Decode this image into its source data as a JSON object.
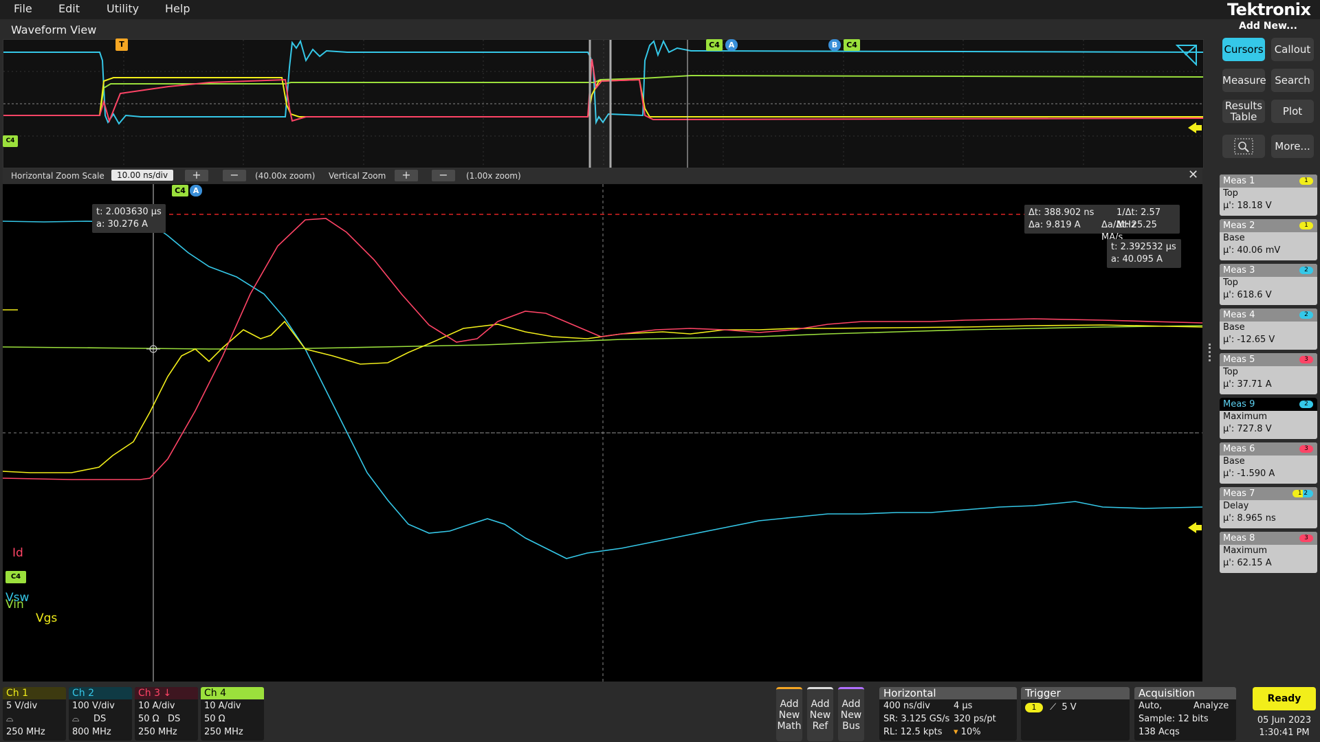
{
  "menu": [
    "File",
    "Edit",
    "Utility",
    "Help"
  ],
  "brand": "Tektronix",
  "add_new": "Add New...",
  "waveform_view": {
    "title": "Waveform View"
  },
  "zoom": {
    "h_label": "Horizontal Zoom Scale",
    "h_value": "10.00 ns/div",
    "h_factor": "(40.00x zoom)",
    "v_label": "Vertical Zoom",
    "v_factor": "(1.00x zoom)",
    "close": "✕"
  },
  "cursor_a": {
    "t": "t: 2.003630 µs",
    "a": "a: 30.276 A"
  },
  "cursor_b": {
    "t": "t: 2.392532 µs",
    "a": "a: 40.095 A"
  },
  "delta": {
    "dt": "Δt: 388.902 ns",
    "inv_dt": "1/Δt: 2.57 MHz",
    "da": "Δa: 9.819 A",
    "da_dt": "Δa/Δt: 25.25 MA/s"
  },
  "markers": {
    "t": "T",
    "c4": "C4",
    "a": "A",
    "b": "B"
  },
  "trace_labels": {
    "id": "Id",
    "vsw": "Vsw",
    "vin": "Vin",
    "vgs": "Vgs"
  },
  "right_panel": {
    "buttons": [
      "Cursors",
      "Callout",
      "Measure",
      "Search",
      "Results Table",
      "Plot",
      "More..."
    ],
    "measurements": [
      {
        "name": "Meas 1",
        "badge": "1",
        "type": "Top",
        "value": "µ': 18.18 V",
        "color": "#f2ee1a"
      },
      {
        "name": "Meas 2",
        "badge": "1",
        "type": "Base",
        "value": "µ': 40.06 mV",
        "color": "#f2ee1a"
      },
      {
        "name": "Meas 3",
        "badge": "2",
        "type": "Top",
        "value": "µ': 618.6 V",
        "color": "#35c8e8"
      },
      {
        "name": "Meas 4",
        "badge": "2",
        "type": "Base",
        "value": "µ': -12.65 V",
        "color": "#35c8e8"
      },
      {
        "name": "Meas 5",
        "badge": "3",
        "type": "Top",
        "value": "µ': 37.71 A",
        "color": "#ff4466"
      },
      {
        "name": "Meas 9",
        "badge": "2",
        "type": "Maximum",
        "value": "µ': 727.8 V",
        "color": "#35c8e8",
        "active": true
      },
      {
        "name": "Meas 6",
        "badge": "3",
        "type": "Base",
        "value": "µ': -1.590 A",
        "color": "#ff4466"
      },
      {
        "name": "Meas 7",
        "badge": "1  2",
        "type": "Delay",
        "value": "µ': 8.965 ns",
        "color": "#f2ee1a"
      },
      {
        "name": "Meas 8",
        "badge": "3",
        "type": "Maximum",
        "value": "µ': 62.15 A",
        "color": "#ff4466"
      }
    ]
  },
  "channels": [
    {
      "name": "Ch 1",
      "l1": "5 V/div",
      "l2": "",
      "l3": "250 MHz",
      "color": "#f2ee1a"
    },
    {
      "name": "Ch 2",
      "l1": "100 V/div",
      "l2": "DS",
      "l3": "800 MHz",
      "color": "#35c8e8"
    },
    {
      "name": "Ch 3",
      "l1": "10 A/div",
      "l2": "50 Ω   DS",
      "l3": "250 MHz",
      "color": "#ff4466"
    },
    {
      "name": "Ch 4",
      "l1": "10 A/div",
      "l2": "50 Ω",
      "l3": "250 MHz",
      "color": "#9be03c"
    }
  ],
  "add_buttons": [
    {
      "l1": "Add",
      "l2": "New",
      "l3": "Math",
      "color": "#f5a623"
    },
    {
      "l1": "Add",
      "l2": "New",
      "l3": "Ref",
      "color": "#dddddd"
    },
    {
      "l1": "Add",
      "l2": "New",
      "l3": "Bus",
      "color": "#b070ff"
    }
  ],
  "horizontal": {
    "title": "Horizontal",
    "scale": "400 ns/div",
    "length": "4 µs",
    "sr": "SR: 3.125 GS/s",
    "pt": "320 ps/pt",
    "rl": "RL: 12.5 kpts",
    "pos": "10%"
  },
  "trigger": {
    "title": "Trigger",
    "ch": "1",
    "level": "5 V"
  },
  "acquisition": {
    "title": "Acquisition",
    "mode": "Auto,",
    "analyze": "Analyze",
    "sample": "Sample: 12 bits",
    "acqs": "138 Acqs"
  },
  "status": {
    "ready": "Ready",
    "date": "05 Jun 2023",
    "time": "1:30:41 PM"
  }
}
